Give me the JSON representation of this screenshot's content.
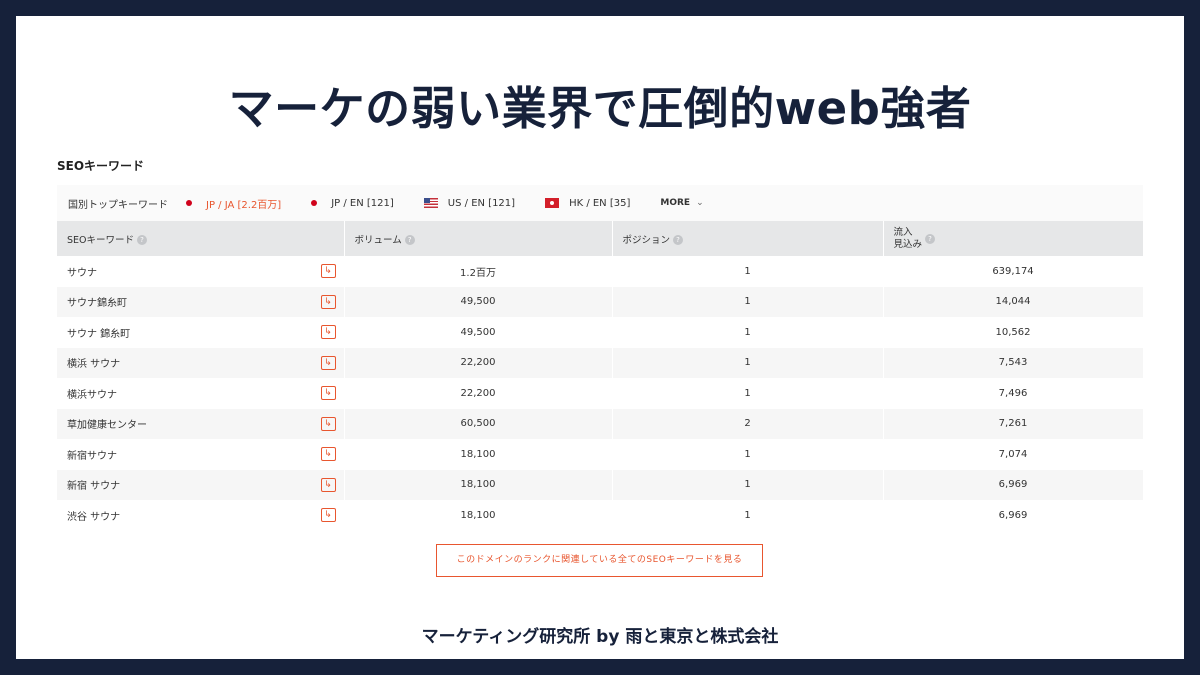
{
  "title": "マーケの弱い業界で圧倒的web強者",
  "section_title": "SEOキーワード",
  "country_bar": {
    "label": "国別トップキーワード",
    "items": [
      {
        "text": "JP / JA  [2.2百万]",
        "flag": "jp",
        "active": true
      },
      {
        "text": "JP / EN  [121]",
        "flag": "jp",
        "active": false
      },
      {
        "text": "US / EN  [121]",
        "flag": "us",
        "active": false
      },
      {
        "text": "HK / EN  [35]",
        "flag": "hk",
        "active": false
      }
    ],
    "more_label": "MORE"
  },
  "table": {
    "headers": [
      {
        "label": "SEOキーワード"
      },
      {
        "label": "ボリューム"
      },
      {
        "label": "ポジション"
      },
      {
        "label_line1": "流入",
        "label_line2": "見込み"
      }
    ],
    "rows": [
      {
        "keyword": "サウナ",
        "volume": "1.2百万",
        "position": "1",
        "traffic": "639,174"
      },
      {
        "keyword": "サウナ錦糸町",
        "volume": "49,500",
        "position": "1",
        "traffic": "14,044"
      },
      {
        "keyword": "サウナ 錦糸町",
        "volume": "49,500",
        "position": "1",
        "traffic": "10,562"
      },
      {
        "keyword": "横浜 サウナ",
        "volume": "22,200",
        "position": "1",
        "traffic": "7,543"
      },
      {
        "keyword": "横浜サウナ",
        "volume": "22,200",
        "position": "1",
        "traffic": "7,496"
      },
      {
        "keyword": "草加健康センター",
        "volume": "60,500",
        "position": "2",
        "traffic": "7,261"
      },
      {
        "keyword": "新宿サウナ",
        "volume": "18,100",
        "position": "1",
        "traffic": "7,074"
      },
      {
        "keyword": "新宿 サウナ",
        "volume": "18,100",
        "position": "1",
        "traffic": "6,969"
      },
      {
        "keyword": "渋谷 サウナ",
        "volume": "18,100",
        "position": "1",
        "traffic": "6,969"
      }
    ]
  },
  "see_all_button": "このドメインのランクに関連している全てのSEOキーワードを見る",
  "footer": "マーケティング研究所 by 雨と東京と株式会社",
  "colors": {
    "navy": "#16213a",
    "accent": "#e8562f",
    "jp_dot": "#d0021b"
  }
}
